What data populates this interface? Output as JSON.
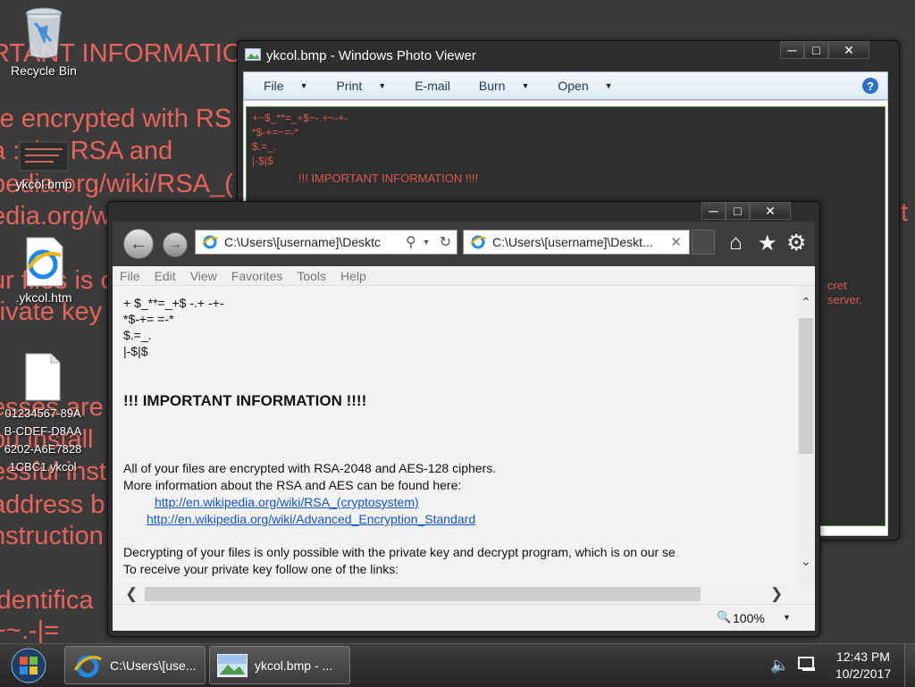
{
  "wallpaper_lines": [
    "RTANT INFORMATIO",
    "re encrypted with RS",
    "a        : the RSA and",
    "pedia.org/wiki/RSA_(",
    "edia.org/wiki/Advan",
    "ur files is o",
    "rivate key",
    "esses are",
    "ou install",
    "essful inst",
    "address b",
    "nstruction",
    "identifica",
    "~~.-|="
  ],
  "desktop_icons": [
    {
      "label": "Recycle Bin",
      "icon": "recycle-bin-icon"
    },
    {
      "label": "ykcol.bmp",
      "icon": "bitmap-file-icon"
    },
    {
      "label": ".ykcol.htm",
      "icon": "internet-explorer-icon"
    },
    {
      "label": "01234567-89AB-CDEF-D8AA6202-A6E78281CBC1.ykcol",
      "icon": "blank-file-icon"
    }
  ],
  "photo_viewer": {
    "title": "ykcol.bmp - Windows Photo Viewer",
    "menu": [
      "File",
      "Print",
      "E-mail",
      "Burn",
      "Open"
    ],
    "help_icon": "help-icon",
    "image_lines": [
      "+~$_**=_+$~-.+~-+-",
      "*$-+=~=-*",
      "$.=_.",
      "|-$|$"
    ],
    "image_heading": "!!! IMPORTANT INFORMATION !!!!",
    "image_partial_text": "cret server."
  },
  "ie": {
    "address": "C:\\Users\\[username]\\Desktc",
    "tab_title": "C:\\Users\\[username]\\Deskt...",
    "menu": [
      "File",
      "Edit",
      "View",
      "Favorites",
      "Tools",
      "Help"
    ],
    "zoom": "100%",
    "content": {
      "ascii_lines": [
        "+  $_**=_+$  -.+ -+-",
        "*$-+=  =-*",
        "$.=_.",
        "|-$|$"
      ],
      "heading": "!!! IMPORTANT INFORMATION  !!!!",
      "para1_line1": "All  of  your files  are  encrypted  with RSA-2048 and  AES-128 ciphers.",
      "para1_line2": "More  information  about  the RSA  and AES  can be  found here:",
      "link1": "http://en.wikipedia.org/wiki/RSA_(cryptosystem)",
      "link2": "http://en.wikipedia.org/wiki/Advanced_Encryption_Standard",
      "para2_line1": "Decrypting of your  files  is  only  possible  with the private key  and  decrypt  program,  which is  on  our se",
      "para2_line2": "To  receive  your private key follow  one of  the links:"
    }
  },
  "taskbar": {
    "ie_button": "C:\\Users\\[use...",
    "pv_button": "ykcol.bmp - ...",
    "time": "12:43 PM",
    "date": "10/2/2017"
  }
}
